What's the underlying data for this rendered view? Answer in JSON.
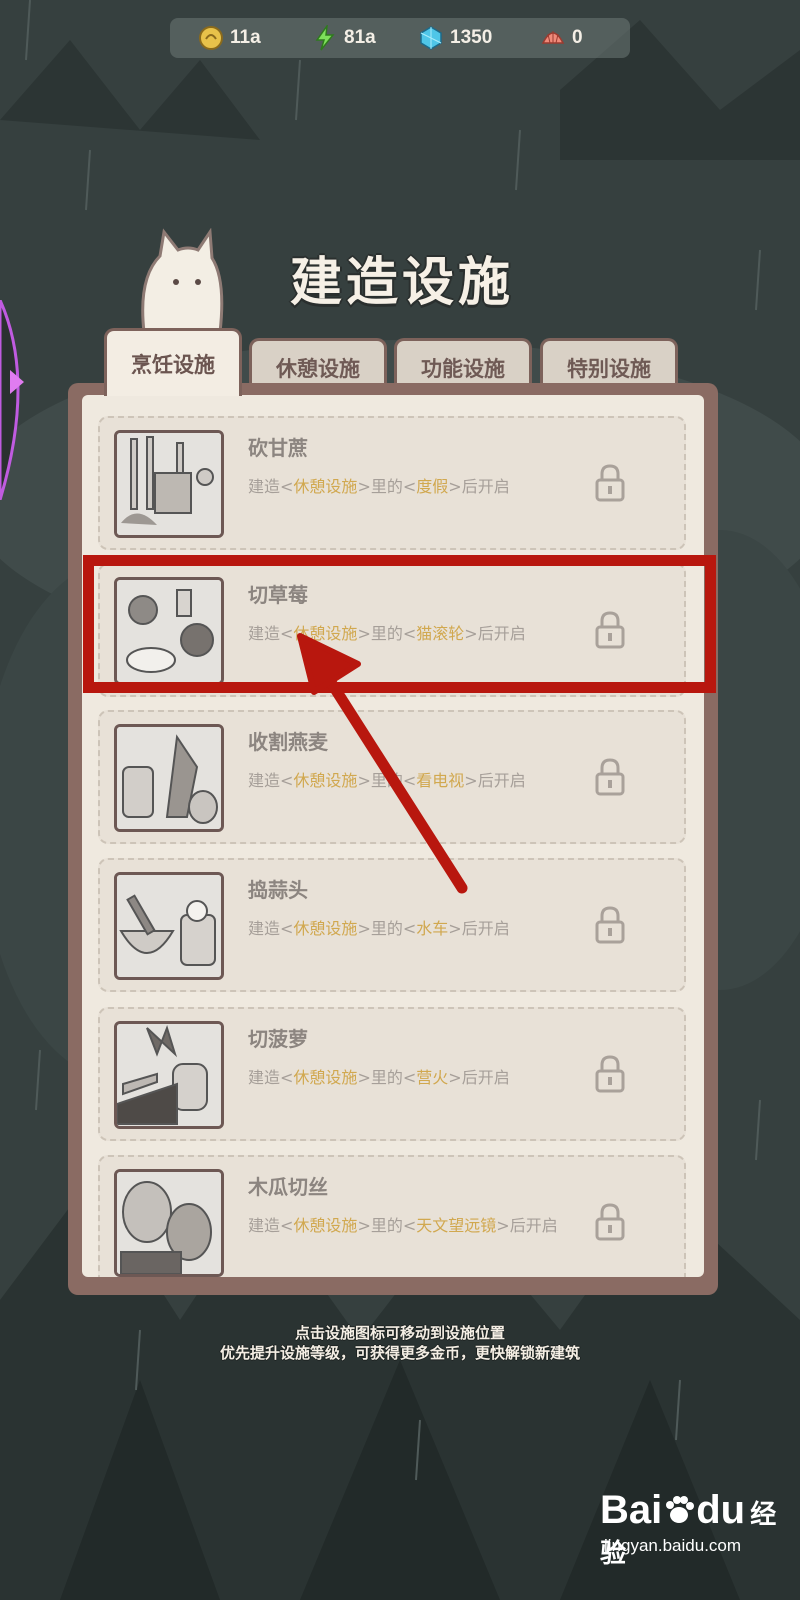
{
  "resources": [
    {
      "icon": "coin-icon",
      "value": "11a"
    },
    {
      "icon": "energy-bolt-icon",
      "value": "81a"
    },
    {
      "icon": "gem-icon",
      "value": "1350"
    },
    {
      "icon": "shell-icon",
      "value": "0"
    }
  ],
  "title": "建造设施",
  "tabs": [
    "烹饪设施",
    "休憩设施",
    "功能设施",
    "特别设施"
  ],
  "active_tab": 0,
  "facilities": [
    {
      "name": "砍甘蔗",
      "desc_prefix": "建造<",
      "category": "休憩设施",
      "desc_mid": ">里的<",
      "requirement": "度假",
      "desc_suffix": ">后开启"
    },
    {
      "name": "切草莓",
      "desc_prefix": "建造<",
      "category": "休憩设施",
      "desc_mid": ">里的<",
      "requirement": "猫滚轮",
      "desc_suffix": ">后开启"
    },
    {
      "name": "收割燕麦",
      "desc_prefix": "建造<",
      "category": "休憩设施",
      "desc_mid": ">里的<",
      "requirement": "看电视",
      "desc_suffix": ">后开启"
    },
    {
      "name": "捣蒜头",
      "desc_prefix": "建造<",
      "category": "休憩设施",
      "desc_mid": ">里的<",
      "requirement": "水车",
      "desc_suffix": ">后开启"
    },
    {
      "name": "切菠萝",
      "desc_prefix": "建造<",
      "category": "休憩设施",
      "desc_mid": ">里的<",
      "requirement": "营火",
      "desc_suffix": ">后开启"
    },
    {
      "name": "木瓜切丝",
      "desc_prefix": "建造<",
      "category": "休憩设施",
      "desc_mid": ">里的<",
      "requirement": "天文望远镜",
      "desc_suffix": ">后开启"
    }
  ],
  "hints": [
    "点击设施图标可移动到设施位置",
    "优先提升设施等级，可获得更多金币，更快解锁新建筑"
  ],
  "watermark": {
    "logo": "Bai",
    "logo2": "du",
    "cn": "经验",
    "url": "jingyan.baidu.com"
  },
  "colors": {
    "highlight": "#b8170e",
    "accent_text": "#d1a84f"
  }
}
